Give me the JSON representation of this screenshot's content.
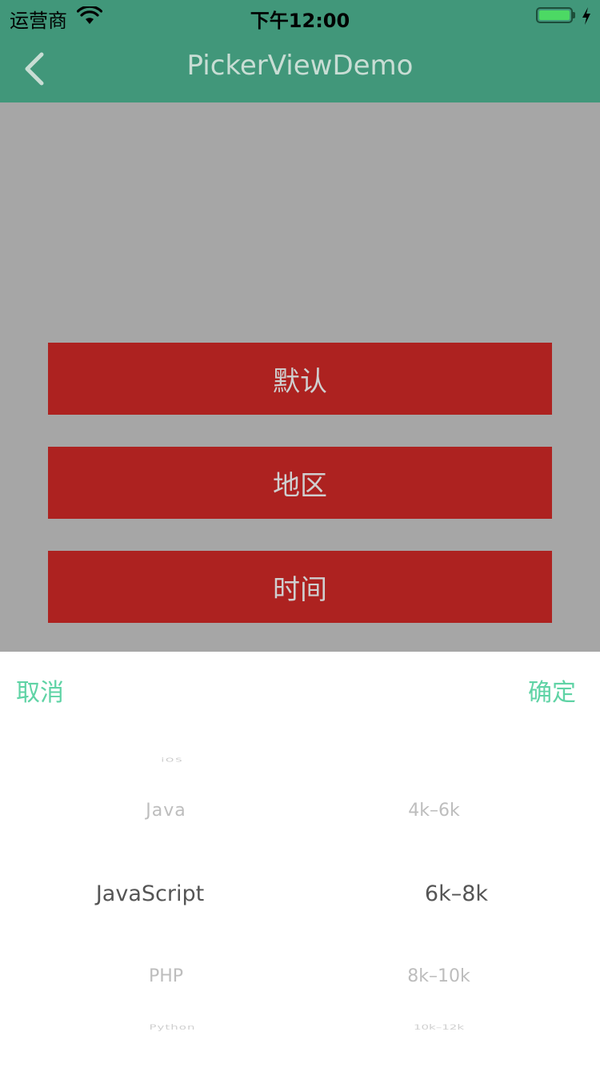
{
  "status_bar": {
    "carrier": "运营商",
    "time": "下午12:00",
    "battery_level": 1.0
  },
  "nav": {
    "title": "PickerViewDemo",
    "back_icon": "chevron-left-icon"
  },
  "buttons": [
    {
      "label": "默认"
    },
    {
      "label": "地区"
    },
    {
      "label": "时间"
    }
  ],
  "picker": {
    "cancel_label": "取消",
    "confirm_label": "确定",
    "accent": "#5fd3a5",
    "language_column": [
      "iOS",
      "Java",
      "JavaScript",
      "PHP",
      "Python"
    ],
    "language_selected": "JavaScript",
    "salary_column": [
      "4k–6k",
      "6k–8k",
      "8k–10k",
      "10k–12k"
    ],
    "salary_selected": "6k–8k"
  },
  "colors": {
    "nav_bg": "#41977a",
    "button_bg": "#ad2220",
    "overlay_bg": "#a6a6a6"
  }
}
